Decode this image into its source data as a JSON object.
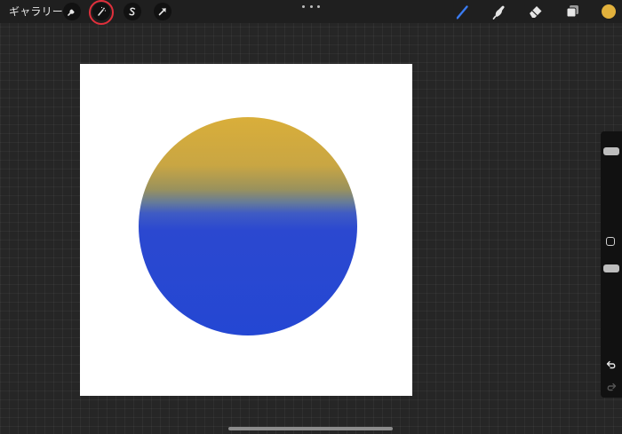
{
  "topbar": {
    "gallery_label": "ギャラリー",
    "tools_left": [
      "wrench-icon",
      "magic-wand-icon",
      "selection-s-icon",
      "transform-arrow-icon"
    ],
    "more_menu": "more-dots-icon",
    "tools_right": [
      "brush-icon",
      "smudge-icon",
      "eraser-icon",
      "layers-icon"
    ],
    "active_tool": "brush-icon",
    "highlighted_tool": "magic-wand-icon",
    "highlight_color": "#e0303c",
    "current_color": "#e2b13c"
  },
  "canvas": {
    "background": "#ffffff",
    "shape": "circle",
    "gradient_top_color": "#d9ae3a",
    "gradient_bottom_color": "#2447d3"
  },
  "sidebar": {
    "brush_size_level": 0.9,
    "brush_opacity_level": 0.9,
    "undo": "undo-icon",
    "redo": "redo-icon"
  }
}
